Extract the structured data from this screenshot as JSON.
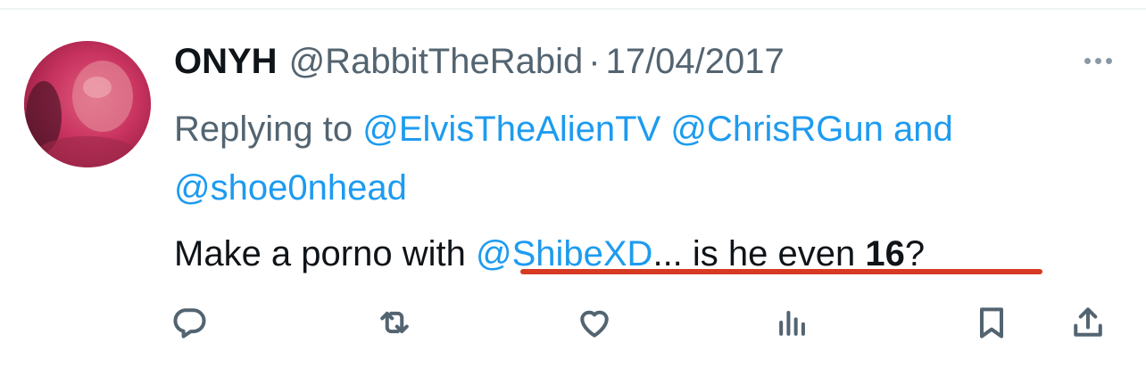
{
  "tweet": {
    "display_name": "ONYH",
    "handle": "@RabbitTheRabid",
    "separator": "·",
    "date": "17/04/2017",
    "replying_prefix": "Replying to",
    "reply_mentions": [
      "@ElvisTheAlienTV",
      "@ChrisRGun"
    ],
    "reply_and": "and",
    "reply_last_mention": "@shoe0nhead",
    "text_part1": "Make a porno with",
    "text_mention": "@ShibeXD",
    "text_part2": "... is he even",
    "text_bold": "16",
    "text_part3": "?"
  },
  "icons": {
    "more": "more-horizontal-icon",
    "reply": "reply-bubble-icon",
    "retweet": "retweet-icon",
    "like": "heart-icon",
    "views": "analytics-bars-icon",
    "bookmark": "bookmark-icon",
    "share": "share-upload-icon"
  },
  "colors": {
    "text": "#0f1419",
    "secondary": "#536471",
    "link": "#1d9bf0",
    "annotation_underline": "#d63a23",
    "avatar": "#c8335f"
  }
}
